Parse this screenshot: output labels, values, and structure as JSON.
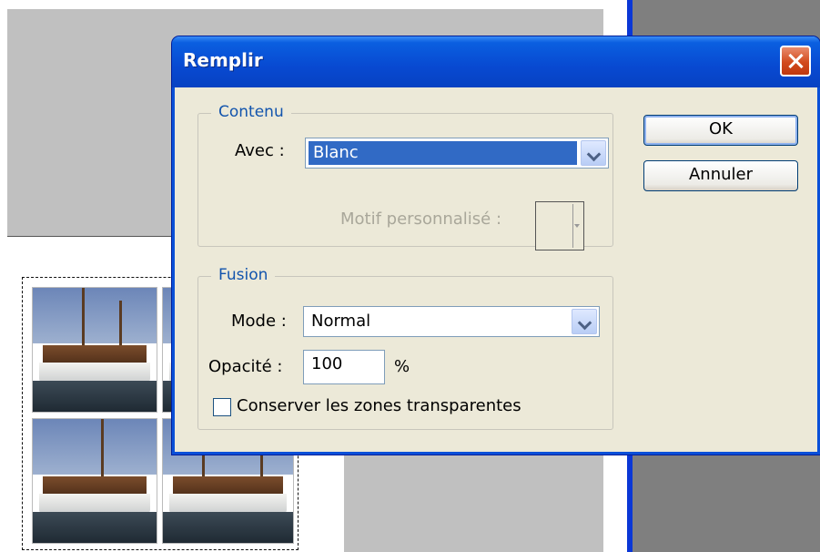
{
  "dialog": {
    "title": "Remplir",
    "contenu": {
      "legend": "Contenu",
      "avec_label": "Avec :",
      "avec_value": "Blanc",
      "motif_label": "Motif personnalisé :"
    },
    "fusion": {
      "legend": "Fusion",
      "mode_label": "Mode :",
      "mode_value": "Normal",
      "opacite_label": "Opacité :",
      "opacite_value": "100",
      "opacite_unit": "%",
      "preserve_label": "Conserver les zones transparentes",
      "preserve_checked": false
    },
    "buttons": {
      "ok": "OK",
      "cancel": "Annuler"
    }
  },
  "colors": {
    "titlebar": "#0849d1",
    "selection": "#316ac5",
    "legend_text": "#1254ad",
    "dialog_bg": "#ece9d8"
  }
}
